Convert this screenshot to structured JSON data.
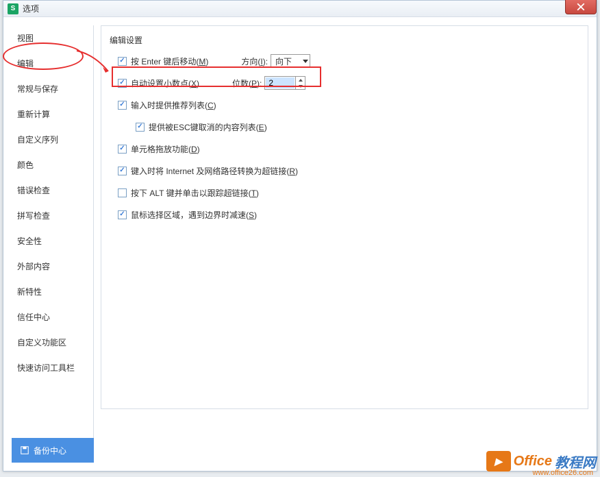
{
  "window": {
    "title": "选项"
  },
  "close": {
    "label": "✕"
  },
  "sidebar": {
    "items": [
      {
        "label": "视图"
      },
      {
        "label": "编辑"
      },
      {
        "label": "常规与保存"
      },
      {
        "label": "重新计算"
      },
      {
        "label": "自定义序列"
      },
      {
        "label": "颜色"
      },
      {
        "label": "错误检查"
      },
      {
        "label": "拼写检查"
      },
      {
        "label": "安全性"
      },
      {
        "label": "外部内容"
      },
      {
        "label": "新特性"
      },
      {
        "label": "信任中心"
      },
      {
        "label": "自定义功能区"
      },
      {
        "label": "快速访问工具栏"
      }
    ],
    "backup": "备份中心"
  },
  "content": {
    "section_title": "编辑设置",
    "rows": {
      "enter_move": "按 Enter 键后移动(M)",
      "direction_label": "方向(I):",
      "direction_value": "向下",
      "auto_decimal": "自动设置小数点(X)",
      "places_label": "位数(P):",
      "places_value": "2",
      "input_suggest": "输入时提供推荐列表(C)",
      "esc_list": "提供被ESC键取消的内容列表(E)",
      "cell_drag": "单元格拖放功能(D)",
      "internet_link": "键入时将 Internet 及网络路径转换为超链接(R)",
      "alt_click": "按下 ALT 键并单击以跟踪超链接(T)",
      "mouse_select": "鼠标选择区域，遇到边界时减速(S)"
    }
  },
  "watermark": {
    "text1": "Office",
    "text2": "教程网",
    "url": "www.office26.com"
  }
}
